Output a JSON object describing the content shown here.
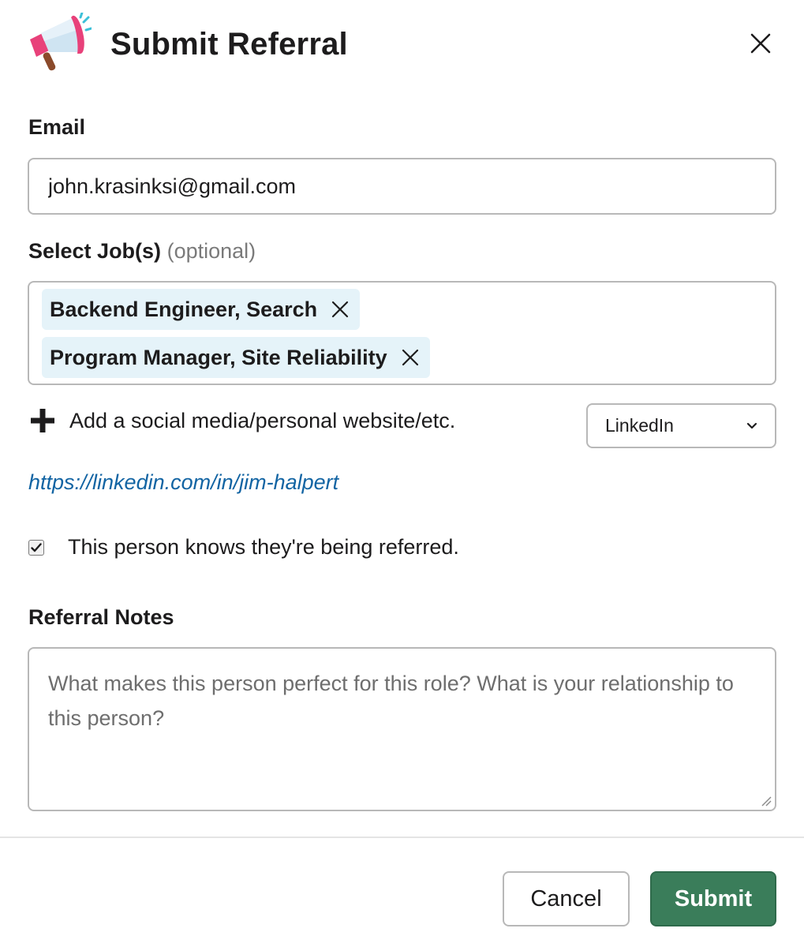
{
  "modal": {
    "title": "Submit Referral",
    "icon": "megaphone-icon"
  },
  "email": {
    "label": "Email",
    "value": "john.krasinksi@gmail.com"
  },
  "jobs": {
    "label": "Select Job(s)",
    "optional": "(optional)",
    "selected": [
      "Backend Engineer, Search",
      "Program Manager, Site Reliability"
    ]
  },
  "social": {
    "add_label": "Add a social media/personal website/etc.",
    "platform_selected": "LinkedIn",
    "url": "https://linkedin.com/in/jim-halpert"
  },
  "consent": {
    "label": "This person knows they're being referred.",
    "checked": true
  },
  "notes": {
    "label": "Referral Notes",
    "placeholder": "What makes this person perfect for this role? What is your relationship to this person?"
  },
  "footer": {
    "cancel_label": "Cancel",
    "submit_label": "Submit"
  },
  "colors": {
    "submit_bg": "#3a7d5a",
    "link": "#1264a3",
    "chip_bg": "#e5f3f9"
  }
}
